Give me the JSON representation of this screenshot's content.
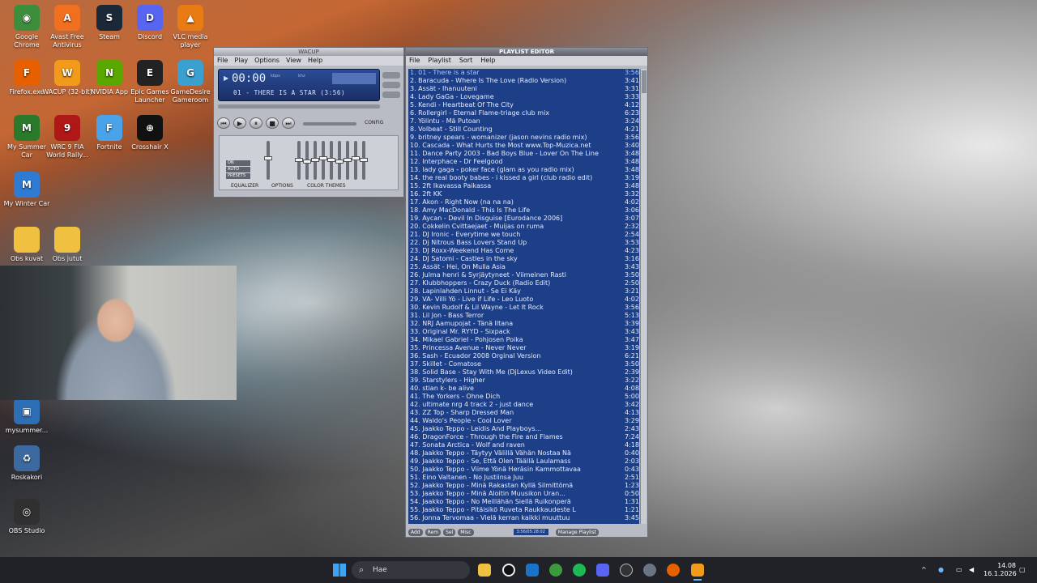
{
  "desktop": {
    "icons": [
      {
        "label": "Google Chrome",
        "color": "#3c8d3c",
        "glyph": "◉"
      },
      {
        "label": "Avast Free Antivirus",
        "color": "#f07020",
        "glyph": "A"
      },
      {
        "label": "Steam",
        "color": "#1b2838",
        "glyph": "S"
      },
      {
        "label": "Discord",
        "color": "#5865f2",
        "glyph": "D"
      },
      {
        "label": "VLC media player",
        "color": "#e87b13",
        "glyph": "▲"
      },
      {
        "label": "Firefox.exe",
        "color": "#e66000",
        "glyph": "F"
      },
      {
        "label": "WACUP (32-bit)",
        "color": "#f29a1a",
        "glyph": "W"
      },
      {
        "label": "NVIDIA App",
        "color": "#5aa700",
        "glyph": "N"
      },
      {
        "label": "Epic Games Launcher",
        "color": "#222222",
        "glyph": "E"
      },
      {
        "label": "GameDesire Gameroom",
        "color": "#3aa0d0",
        "glyph": "G"
      },
      {
        "label": "My Summer Car",
        "color": "#2b7a2b",
        "glyph": "M"
      },
      {
        "label": "WRC 9 FIA World Rally...",
        "color": "#b01818",
        "glyph": "9"
      },
      {
        "label": "Fortnite",
        "color": "#4aa3e8",
        "glyph": "F"
      },
      {
        "label": "Crosshair X",
        "color": "#111111",
        "glyph": "⊕"
      },
      {
        "label": "My Winter Car",
        "color": "#2f7bd1",
        "glyph": "M"
      },
      {
        "label": "Obs kuvat",
        "color": "#f0c040",
        "glyph": ""
      },
      {
        "label": "Obs jutut",
        "color": "#f0c040",
        "glyph": ""
      },
      {
        "label": "mysummer...",
        "color": "#2c6fb5",
        "glyph": "▣"
      },
      {
        "label": "Roskakori",
        "color": "#3c6aa0",
        "glyph": "♻"
      },
      {
        "label": "OBS Studio",
        "color": "#303030",
        "glyph": "◎"
      }
    ]
  },
  "player": {
    "title": "WACUP",
    "menu": [
      "File",
      "Play",
      "Options",
      "View",
      "Help"
    ],
    "time": "00:00",
    "kbps": "kbps",
    "khz": "khz",
    "track": "01 - THERE IS A STAR (3:56)",
    "controls": [
      "prev",
      "play",
      "pause",
      "stop",
      "next"
    ],
    "eq_tabs": [
      "EQUALIZER",
      "OPTIONS",
      "COLOR THEMES"
    ],
    "eq_buttons": [
      "ON",
      "AUTO",
      "PRESETS"
    ],
    "config": "CONFIG",
    "eq_levels": [
      0.55,
      0.5,
      0.45,
      0.5,
      0.55,
      0.5,
      0.45,
      0.5,
      0.55,
      0.5
    ]
  },
  "playlist": {
    "title": "PLAYLIST EDITOR",
    "menu": [
      "File",
      "Playlist",
      "Sort",
      "Help"
    ],
    "buttons": [
      "Add",
      "Rem",
      "Sel",
      "Misc"
    ],
    "status": "3:56/05:28:02",
    "manage": "Manage Playlist",
    "items": [
      {
        "t": "1. 01 - There is a star",
        "d": "3:56"
      },
      {
        "t": "2. Baracuda - Where Is The Love (Radio Version)",
        "d": "3:41"
      },
      {
        "t": "3. Assät - Ihanuuteni",
        "d": "3:31"
      },
      {
        "t": "4. Lady GaGa - Lovegame",
        "d": "3:33"
      },
      {
        "t": "5. Kendi - Heartbeat Of The City",
        "d": "4:12"
      },
      {
        "t": "6. Rollergirl - Eternal Flame-triage club mix",
        "d": "6:23"
      },
      {
        "t": "7. Yölintu - Mä Putoan",
        "d": "3:24"
      },
      {
        "t": "8. Volbeat - Still Counting",
        "d": "4:21"
      },
      {
        "t": "9. britney spears - womanizer (jason nevins radio mix)",
        "d": "3:56"
      },
      {
        "t": "10. Cascada - What Hurts the Most www.Top-Muzica.net",
        "d": "3:40"
      },
      {
        "t": "11. Dance Party 2003 - Bad Boys Blue - Lover On The Line",
        "d": "3:48"
      },
      {
        "t": "12. Interphace - Dr Feelgood",
        "d": "3:48"
      },
      {
        "t": "13. lady gaga - poker face (glam as you radio mix)",
        "d": "3:48"
      },
      {
        "t": "14. the real booty babes - i kissed a girl (club radio edit)",
        "d": "3:19"
      },
      {
        "t": "15. 2ft Ikavassa Paikassa",
        "d": "3:48"
      },
      {
        "t": "16. 2ft KK",
        "d": "3:32"
      },
      {
        "t": "17. Akon - Right Now (na na na)",
        "d": "4:02"
      },
      {
        "t": "18. Amy MacDonald - This Is The Life",
        "d": "3:06"
      },
      {
        "t": "19. Aycan - Devil In Disguise [Eurodance 2006]",
        "d": "3:07"
      },
      {
        "t": "20. Cokkelin Cvittaejaet - Muijas on ruma",
        "d": "2:32"
      },
      {
        "t": "21. DJ Ironic - Everytime we touch",
        "d": "2:54"
      },
      {
        "t": "22. Dj Nitrous Bass Lovers Stand Up",
        "d": "3:53"
      },
      {
        "t": "23. DJ Roxx-Weekend Has Come",
        "d": "4:23"
      },
      {
        "t": "24. DJ Satomi - Castles in the sky",
        "d": "3:16"
      },
      {
        "t": "25. Assät - Hei, On Mulla Asia",
        "d": "3:43"
      },
      {
        "t": "26. Julma henri & Syrjäytyneet - Viimeinen Rasti",
        "d": "3:50"
      },
      {
        "t": "27. Klubbhoppers - Crazy Duck (Radio Edit)",
        "d": "2:50"
      },
      {
        "t": "28. Lapinlahden Linnut - Se Ei Käy",
        "d": "3:21"
      },
      {
        "t": "29. VA- Villi Yö - Live if Life - Leo Luoto",
        "d": "4:02"
      },
      {
        "t": "30. Kevin Rudolf & Lil Wayne - Let It Rock",
        "d": "3:56"
      },
      {
        "t": "31. Lil Jon - Bass Terror",
        "d": "5:13"
      },
      {
        "t": "32. NRJ Aamupojat - Tänä Iltana",
        "d": "3:39"
      },
      {
        "t": "33. Original Mr. RYYD - Sixpack",
        "d": "3:43"
      },
      {
        "t": "34. Mikael Gabriel - Pohjosen Poika",
        "d": "3:47"
      },
      {
        "t": "35. Princessa Avenue - Never Never",
        "d": "3:19"
      },
      {
        "t": "36. Sash - Ecuador 2008 Orginal Version",
        "d": "6:21"
      },
      {
        "t": "37. Skillet - Comatose",
        "d": "3:50"
      },
      {
        "t": "38. Solid Base - Stay With Me (DjLexus Video Edit)",
        "d": "2:39"
      },
      {
        "t": "39. Starstylers - Higher",
        "d": "3:22"
      },
      {
        "t": "40. stian k- be alive",
        "d": "4:08"
      },
      {
        "t": "41. The Yorkers - Ohne Dich",
        "d": "5:00"
      },
      {
        "t": "42. ultimate nrg 4 track 2 - just dance",
        "d": "3:42"
      },
      {
        "t": "43. ZZ Top - Sharp Dressed Man",
        "d": "4:13"
      },
      {
        "t": "44. Waldo's People - Cool Lover",
        "d": "3:29"
      },
      {
        "t": "45. Jaakko Teppo - Leidis And Playboys...",
        "d": "2:43"
      },
      {
        "t": "46. DragonForce - Through the Fire and Flames",
        "d": "7:24"
      },
      {
        "t": "47. Sonata Arctica - Wolf and raven",
        "d": "4:18"
      },
      {
        "t": "48. Jaakko Teppo - Täytyy Välillä Vähän Nostaa Nä",
        "d": "0:40"
      },
      {
        "t": "49. Jaakko Teppo - Se, Että Olen Täällä Laulamass",
        "d": "2:03"
      },
      {
        "t": "50. Jaakko Teppo - Viime Yönä Heräsin Kammottavaa",
        "d": "0:43"
      },
      {
        "t": "51. Eino Valtanen - No Justiinsa Juu",
        "d": "2:51"
      },
      {
        "t": "52. Jaakko Teppo - Minä Rakastan Kyllä Silmittömä",
        "d": "1:23"
      },
      {
        "t": "53. Jaakko Teppo - Minä Aloitin Muusikon Uran...",
        "d": "0:50"
      },
      {
        "t": "54. Jaakko Teppo - No Meillähän Siellä Ruikonperä",
        "d": "1:31"
      },
      {
        "t": "55. Jaakko Teppo - Pitäisikö Ruveta Raukkaudeste L",
        "d": "1:21"
      },
      {
        "t": "56. Jonna Tervomaa - Vielä kerran kaikki muuttuu",
        "d": "3:45"
      }
    ]
  },
  "taskbar": {
    "search": "Hae",
    "time": "14.08",
    "date": "16.1.2026"
  }
}
